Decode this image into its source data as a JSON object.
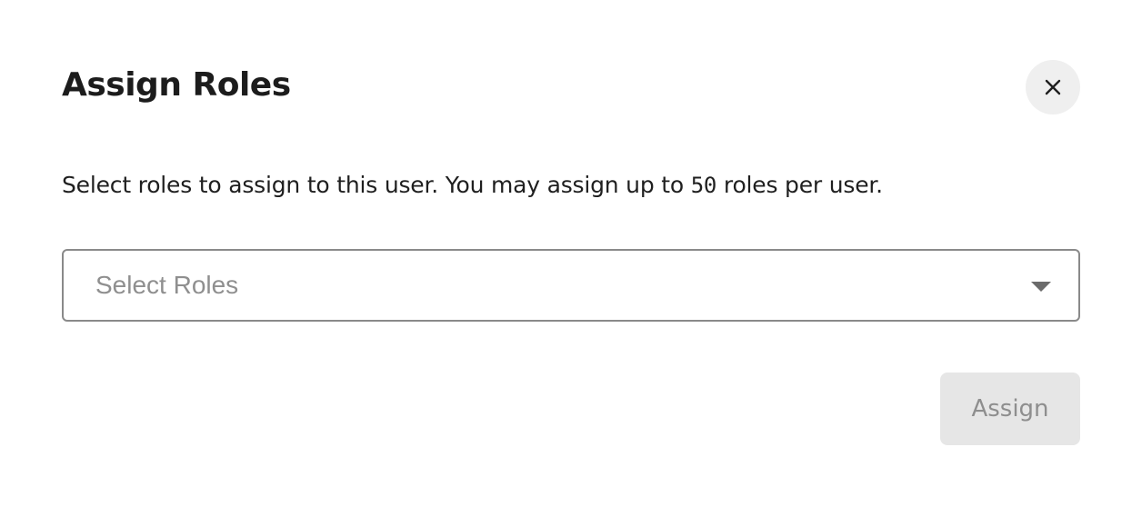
{
  "dialog": {
    "title": "Assign Roles",
    "close_icon": "close-icon",
    "description": {
      "before": "Select roles to assign to this user. You may assign up to ",
      "limit": "50",
      "after": " roles per user."
    },
    "select": {
      "placeholder": "Select Roles",
      "icon": "chevron-down-icon"
    },
    "assign_button": {
      "label": "Assign",
      "disabled": true
    }
  }
}
